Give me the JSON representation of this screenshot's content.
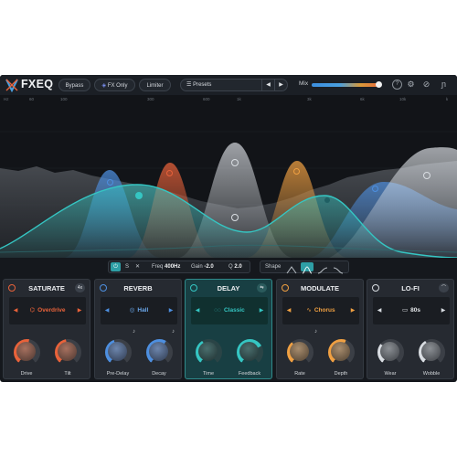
{
  "app": {
    "name": "FXEQ"
  },
  "toolbar": {
    "bypass": "Bypass",
    "fx_only": "FX Only",
    "limiter": "Limiter",
    "presets": "Presets",
    "mix_label": "Mix",
    "prev": "◀",
    "next": "▶"
  },
  "mix": {
    "level": 0.97
  },
  "freq_labels": [
    "Hz",
    "60",
    "100",
    "300",
    "600",
    "1k",
    "3k",
    "6k",
    "10k",
    "k"
  ],
  "band": {
    "s": "S",
    "freq_label": "Freq",
    "freq_value": "400Hz",
    "gain_label": "Gain",
    "gain_value": "-2.0",
    "q_label": "Q",
    "q_value": "2.0"
  },
  "shape": {
    "label": "Shape"
  },
  "modules": [
    {
      "title": "SATURATE",
      "badge": "4x",
      "value": "Overdrive",
      "glyph": "⌬",
      "knob1": "Drive",
      "knob2": "Tilt"
    },
    {
      "title": "REVERB",
      "value": "Hall",
      "glyph": "◎",
      "knob1": "Pre-Delay",
      "knob2": "Decay"
    },
    {
      "title": "DELAY",
      "value": "Classic",
      "glyph": "◌◌",
      "knob1": "Time",
      "knob2": "Feedback"
    },
    {
      "title": "MODULATE",
      "value": "Chorus",
      "glyph": "∿",
      "knob1": "Rate",
      "knob2": "Depth"
    },
    {
      "title": "LO-FI",
      "value": "80s",
      "glyph": "▭",
      "knob1": "Wear",
      "knob2": "Wobble"
    }
  ],
  "colors": {
    "saturate": "#e8623a",
    "reverb": "#4d8fe0",
    "delay": "#35c6c3",
    "modulate": "#f0a042",
    "lofi": "#d9dde2",
    "accent": "#2e9fa6"
  }
}
